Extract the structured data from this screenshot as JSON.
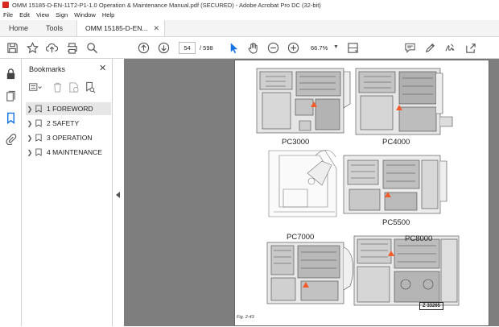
{
  "window": {
    "title": "OMM 15185-D-EN-11T2-P1-1.0 Operation & Maintenance Manual.pdf (SECURED) - Adobe Acrobat Pro DC (32-bit)"
  },
  "menu": [
    "File",
    "Edit",
    "View",
    "Sign",
    "Window",
    "Help"
  ],
  "tabs": {
    "home": "Home",
    "tools": "Tools",
    "document": "OMM 15185-D-EN..."
  },
  "toolbar": {
    "page_current": "54",
    "page_total": "/ 598",
    "zoom": "66.7%"
  },
  "bookmarks": {
    "title": "Bookmarks",
    "items": [
      {
        "label": "1 FOREWORD",
        "selected": true
      },
      {
        "label": "2 SAFETY",
        "selected": false
      },
      {
        "label": "3 OPERATION",
        "selected": false
      },
      {
        "label": "4 MAINTENANCE",
        "selected": false
      }
    ]
  },
  "document_page": {
    "models": [
      "PC3000",
      "PC4000",
      "PC5500",
      "PC7000",
      "PC8000"
    ],
    "badge": "Z 33265",
    "caption": "Fig. 2-43"
  },
  "colors": {
    "accent": "#1473e6",
    "warning": "#f25c2a",
    "canvas": "#7e7e7e"
  }
}
